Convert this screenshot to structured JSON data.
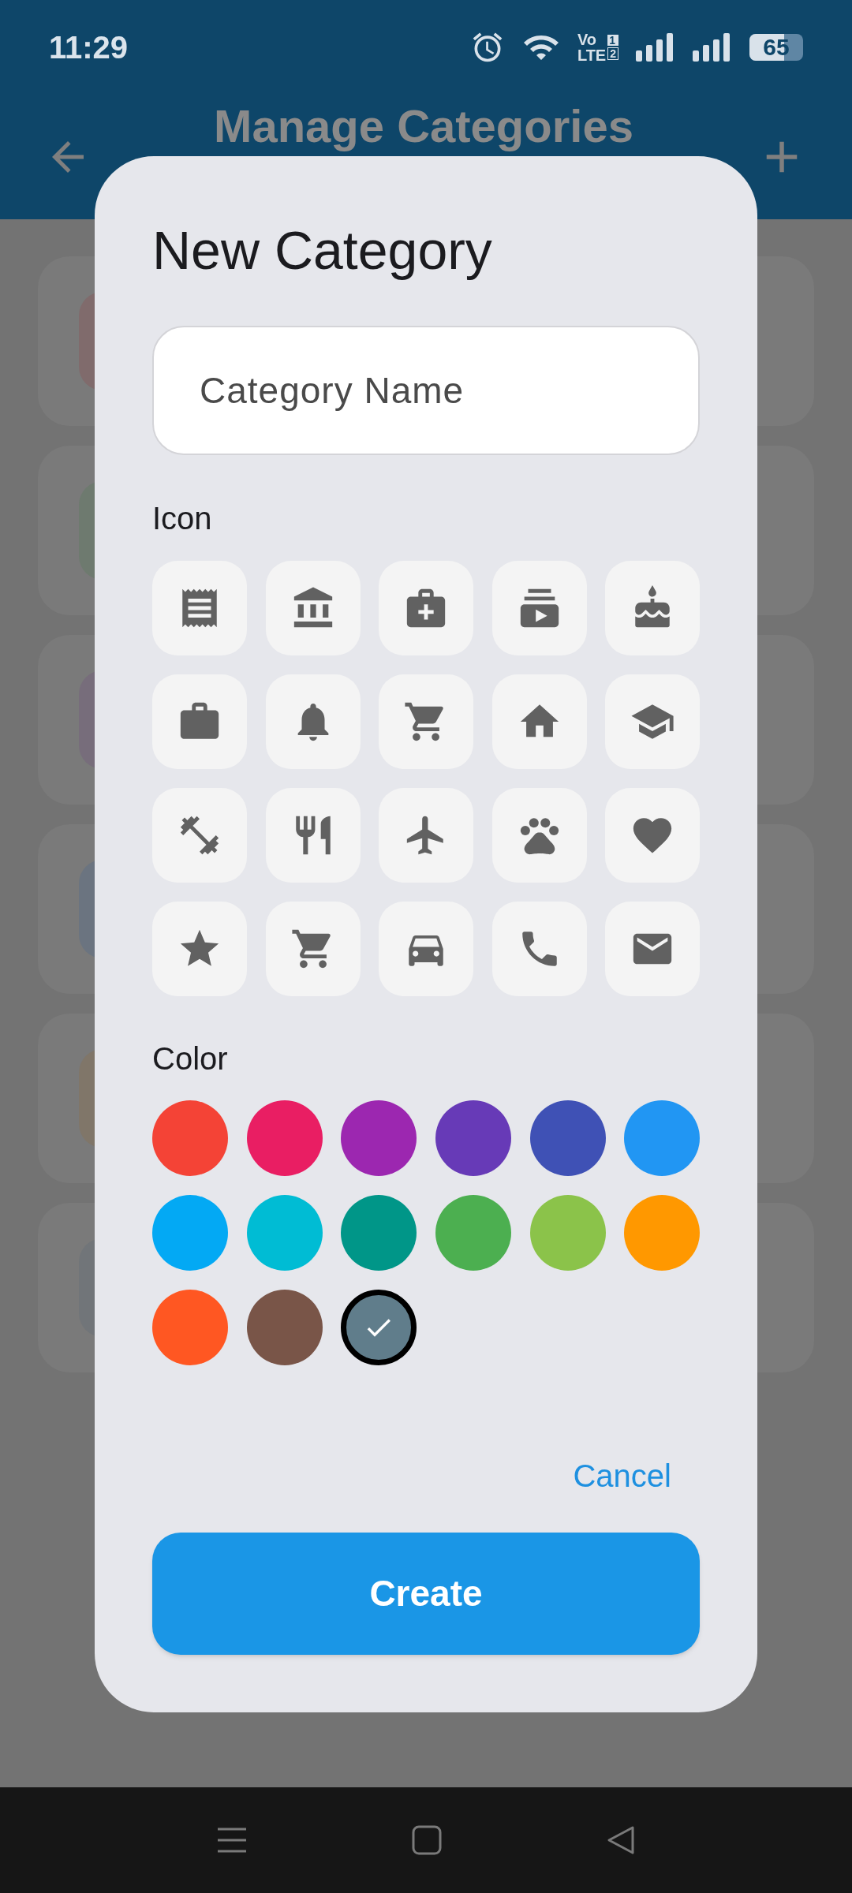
{
  "status_bar": {
    "time": "11:29",
    "volte": [
      "Vo",
      "LTE"
    ],
    "sims": [
      "1",
      "2"
    ],
    "battery": "65"
  },
  "app_bar": {
    "title": "Manage Categories"
  },
  "categories": [
    {
      "color": "#806b6c"
    },
    {
      "color": "#6e7a6f"
    },
    {
      "color": "#776d7b"
    },
    {
      "color": "#6b7480"
    },
    {
      "color": "#807669"
    },
    {
      "color": "#717579"
    }
  ],
  "dialog": {
    "title": "New Category",
    "name_field": {
      "placeholder": "Category Name"
    },
    "icon_label": "Icon",
    "icons": [
      {
        "kind": "receipt"
      },
      {
        "kind": "bank"
      },
      {
        "kind": "medical"
      },
      {
        "kind": "video"
      },
      {
        "kind": "cake"
      },
      {
        "kind": "briefcase"
      },
      {
        "kind": "bell"
      },
      {
        "kind": "cart"
      },
      {
        "kind": "home"
      },
      {
        "kind": "school"
      },
      {
        "kind": "fitness"
      },
      {
        "kind": "restaurant"
      },
      {
        "kind": "flight"
      },
      {
        "kind": "paw"
      },
      {
        "kind": "heart"
      },
      {
        "kind": "star"
      },
      {
        "kind": "cart"
      },
      {
        "kind": "car"
      },
      {
        "kind": "phone"
      },
      {
        "kind": "mail"
      }
    ],
    "color_label": "Color",
    "colors": [
      {
        "color": "#f44336",
        "selected": false
      },
      {
        "color": "#e91e63",
        "selected": false
      },
      {
        "color": "#9c27b0",
        "selected": false
      },
      {
        "color": "#673ab7",
        "selected": false
      },
      {
        "color": "#3f51b5",
        "selected": false
      },
      {
        "color": "#2196f3",
        "selected": false
      },
      {
        "color": "#03a9f4",
        "selected": false
      },
      {
        "color": "#00bcd4",
        "selected": false
      },
      {
        "color": "#009688",
        "selected": false
      },
      {
        "color": "#4caf50",
        "selected": false
      },
      {
        "color": "#8bc34a",
        "selected": false
      },
      {
        "color": "#ff9800",
        "selected": false
      },
      {
        "color": "#ff5722",
        "selected": false
      },
      {
        "color": "#795548",
        "selected": false
      },
      {
        "color": "#607d8b",
        "selected": true
      }
    ],
    "cancel": "Cancel",
    "create": "Create"
  }
}
